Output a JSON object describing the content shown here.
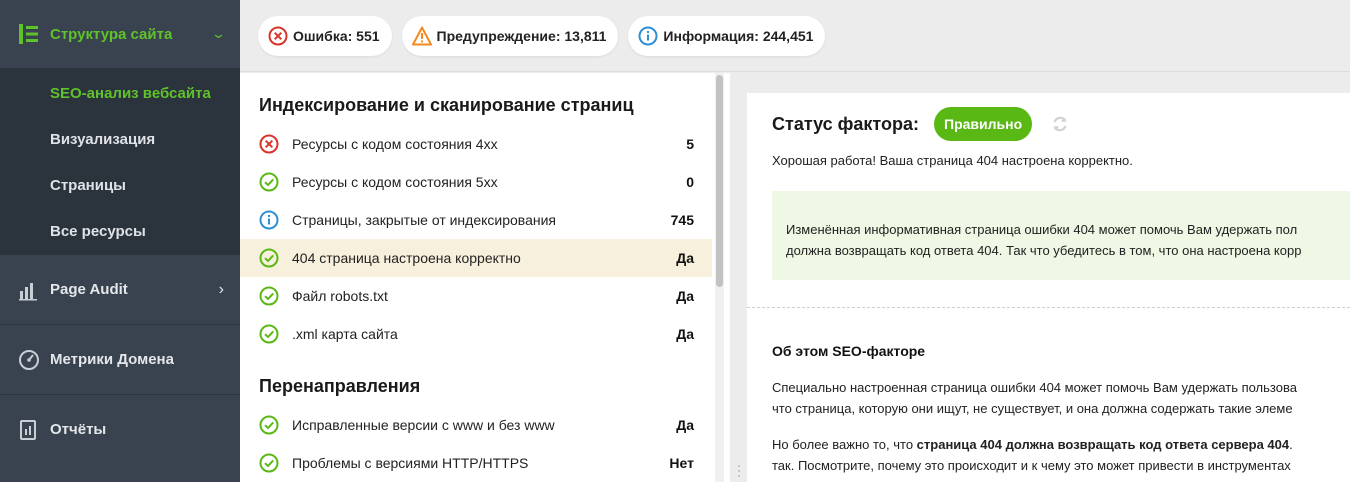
{
  "colors": {
    "accent": "#5fc22a",
    "sidebar_bg": "#39434f",
    "sidebar_sub_bg": "#2b333d",
    "error": "#d9342b",
    "warning": "#f28a20",
    "info": "#2f8fd6",
    "ok": "#5ab814",
    "selected_row": "#f7f0dc",
    "tip_bg": "#eef8e4"
  },
  "sidebar": {
    "section": {
      "label": "Структура сайта",
      "icon": "site-structure-icon",
      "expanded": true
    },
    "subitems": [
      {
        "label": "SEO-анализ вебсайта",
        "active": true
      },
      {
        "label": "Визуализация",
        "active": false
      },
      {
        "label": "Страницы",
        "active": false
      },
      {
        "label": "Все ресурсы",
        "active": false
      }
    ],
    "items": [
      {
        "label": "Page Audit",
        "icon": "page-audit-icon",
        "has_arrow": true
      },
      {
        "label": "Метрики Домена",
        "icon": "gauge-icon",
        "has_arrow": false
      },
      {
        "label": "Отчёты",
        "icon": "reports-icon",
        "has_arrow": false
      }
    ]
  },
  "summary": {
    "error": "Ошибка: 551",
    "warning": "Предупреждение: 13,811",
    "info": "Информация: 244,451"
  },
  "groups": [
    {
      "title": "Индексирование и сканирование страниц",
      "rows": [
        {
          "label": "Ресурсы с кодом состояния 4xx",
          "value": "5",
          "status": "error"
        },
        {
          "label": "Ресурсы с кодом состояния 5xx",
          "value": "0",
          "status": "ok"
        },
        {
          "label": "Страницы, закрытые от индексирования",
          "value": "745",
          "status": "info"
        },
        {
          "label": "404 страница настроена корректно",
          "value": "Да",
          "status": "ok",
          "selected": true
        },
        {
          "label": "Файл robots.txt",
          "value": "Да",
          "status": "ok"
        },
        {
          "label": ".xml карта сайта",
          "value": "Да",
          "status": "ok"
        }
      ]
    },
    {
      "title": "Перенаправления",
      "rows": [
        {
          "label": "Исправленные версии с www и без www",
          "value": "Да",
          "status": "ok"
        },
        {
          "label": "Проблемы с версиями HTTP/HTTPS",
          "value": "Нет",
          "status": "ok"
        }
      ]
    }
  ],
  "detail": {
    "status_title": "Статус фактора:",
    "status_badge": "Правильно",
    "good_text": "Хорошая работа! Ваша страница 404 настроена корректно.",
    "tip_line1": "Изменённая информативная страница ошибки 404 может помочь Вам удержать пол",
    "tip_line2": "должна возвращать код ответа 404. Так что убедитесь в том, что она настроена корр",
    "about_title": "Об этом SEO-факторе",
    "about_p1_line1": "Специально настроенная страница ошибки 404 может помочь Вам удержать пользова",
    "about_p1_line2": "что страница, которую они ищут, не существует, и она должна содержать такие элеме",
    "about_p2_prefix": "Но более важно то, что ",
    "about_p2_bold": "страница 404 должна возвращать код ответа сервера 404",
    "about_p2_suffix": ".",
    "about_p2_line2": "так. Посмотрите, почему это происходит и к чему это может привести в инструментах"
  }
}
